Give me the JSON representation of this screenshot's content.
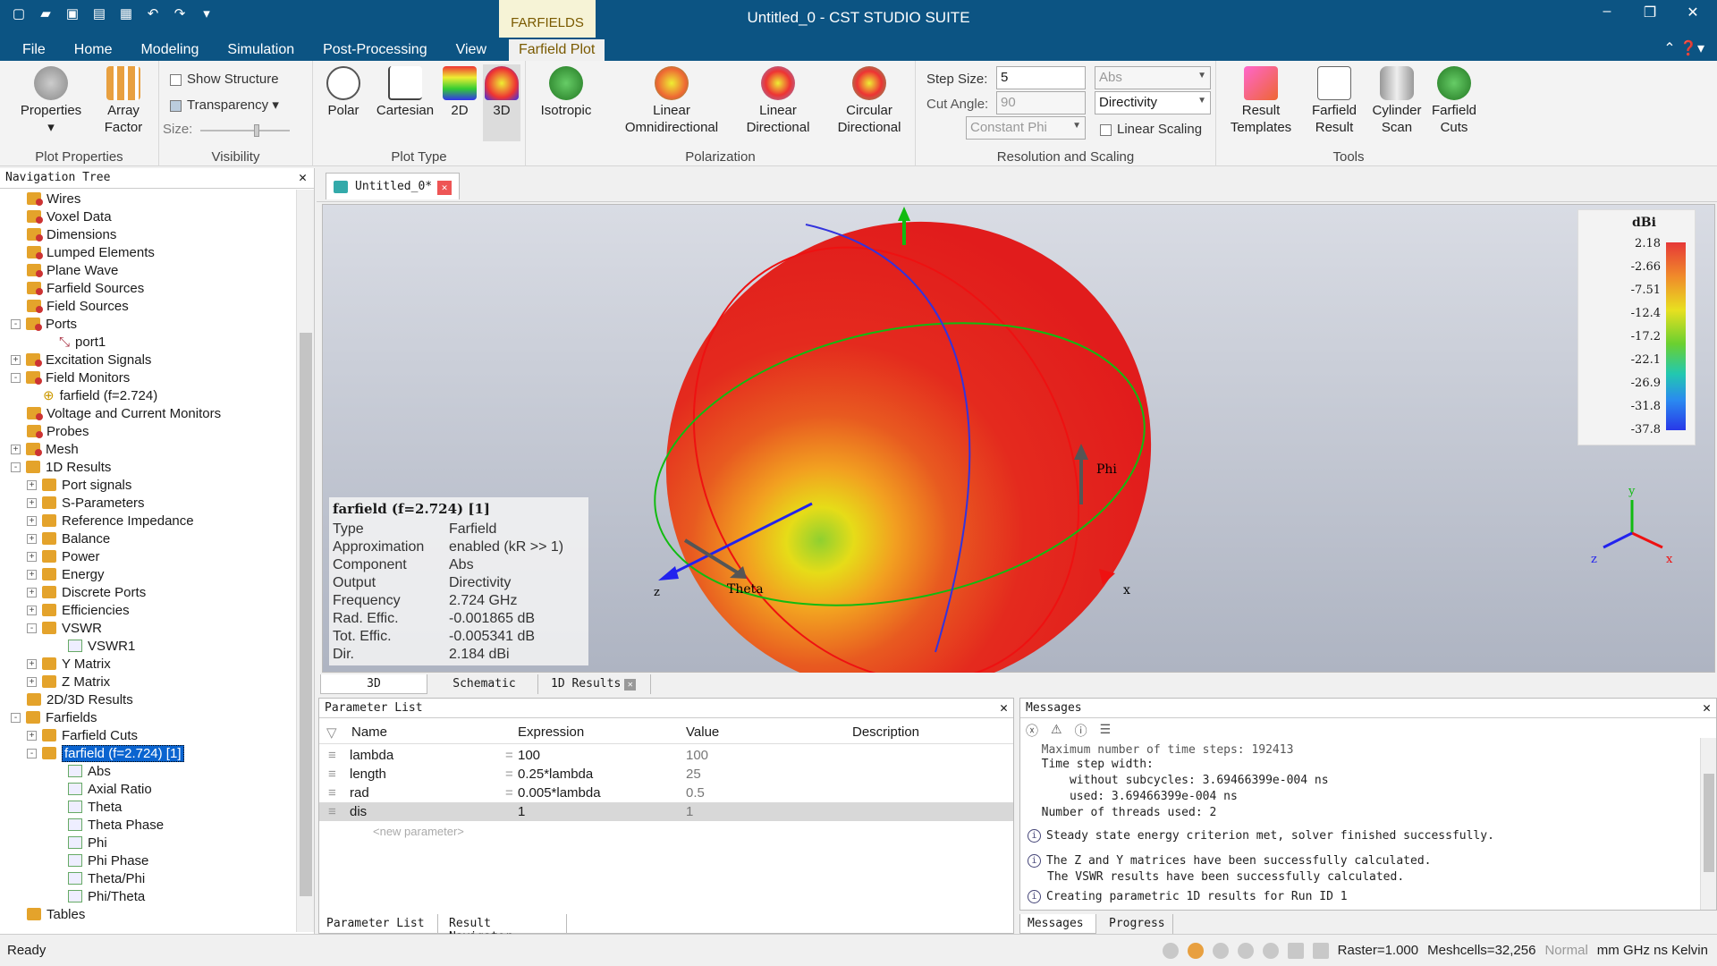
{
  "app": {
    "title": "Untitled_0 - CST STUDIO SUITE",
    "context_tab_group": "FARFIELDS"
  },
  "menu_tabs": [
    "File",
    "Home",
    "Modeling",
    "Simulation",
    "Post-Processing",
    "View",
    "Farfield Plot"
  ],
  "ribbon": {
    "plot_properties": {
      "group": "Plot Properties",
      "properties": "Properties",
      "array_factor": [
        "Array",
        "Factor"
      ]
    },
    "visibility": {
      "group": "Visibility",
      "show_structure": "Show Structure",
      "transparency": "Transparency",
      "size": "Size:"
    },
    "plot_type": {
      "group": "Plot Type",
      "polar": "Polar",
      "cartesian": "Cartesian",
      "2d": "2D",
      "3d": "3D"
    },
    "polarization": {
      "group": "Polarization",
      "isotropic": "Isotropic",
      "linear_omni": [
        "Linear",
        "Omnidirectional"
      ],
      "linear_dir": [
        "Linear",
        "Directional"
      ],
      "circular_dir": [
        "Circular",
        "Directional"
      ]
    },
    "resolution": {
      "group": "Resolution and Scaling",
      "step_size_label": "Step Size:",
      "step_size": "5",
      "cut_angle_label": "Cut Angle:",
      "cut_angle": "90",
      "constant_phi": "Constant Phi",
      "abs": "Abs",
      "directivity": "Directivity",
      "linear_scaling": "Linear Scaling"
    },
    "tools": {
      "group": "Tools",
      "result_templates": [
        "Result",
        "Templates"
      ],
      "farfield_result": [
        "Farfield",
        "Result"
      ],
      "cylinder_scan": [
        "Cylinder",
        "Scan"
      ],
      "farfield_cuts": [
        "Farfield",
        "Cuts"
      ]
    }
  },
  "nav": {
    "title": "Navigation Tree",
    "items": [
      "Wires",
      "Voxel Data",
      "Dimensions",
      "Lumped Elements",
      "Plane Wave",
      "Farfield Sources",
      "Field Sources",
      "Ports",
      "port1",
      "Excitation Signals",
      "Field Monitors",
      "farfield (f=2.724)",
      "Voltage and Current Monitors",
      "Probes",
      "Mesh",
      "1D Results",
      "Port signals",
      "S-Parameters",
      "Reference Impedance",
      "Balance",
      "Power",
      "Energy",
      "Discrete Ports",
      "Efficiencies",
      "VSWR",
      "VSWR1",
      "Y Matrix",
      "Z Matrix",
      "2D/3D Results",
      "Farfields",
      "Farfield Cuts",
      "farfield (f=2.724) [1]",
      "Abs",
      "Axial Ratio",
      "Theta",
      "Theta Phase",
      "Phi",
      "Phi Phase",
      "Theta/Phi",
      "Phi/Theta",
      "Tables"
    ]
  },
  "doc_tab": "Untitled_0*",
  "info": {
    "header": "farfield (f=2.724) [1]",
    "rows": [
      [
        "Type",
        "Farfield"
      ],
      [
        "Approximation",
        "enabled (kR >> 1)"
      ],
      [
        "Component",
        "Abs"
      ],
      [
        "Output",
        "Directivity"
      ],
      [
        "Frequency",
        "2.724 GHz"
      ],
      [
        "Rad. Effic.",
        "-0.001865 dB"
      ],
      [
        "Tot. Effic.",
        "-0.005341 dB"
      ],
      [
        "Dir.",
        "2.184 dBi"
      ]
    ]
  },
  "axes_labels": {
    "z": "z",
    "x": "x",
    "theta": "Theta",
    "phi": "Phi",
    "tri_x": "x",
    "tri_y": "y",
    "tri_z": "z"
  },
  "legend": {
    "unit": "dBi",
    "ticks": [
      "2.18",
      "-2.66",
      "-7.51",
      "-12.4",
      "-17.2",
      "-22.1",
      "-26.9",
      "-31.8",
      "-37.8"
    ]
  },
  "view_tabs": [
    "3D",
    "Schematic",
    "1D Results"
  ],
  "params": {
    "title": "Parameter List",
    "headers": [
      "Name",
      "Expression",
      "Value",
      "Description"
    ],
    "rows": [
      [
        "lambda",
        "100",
        "100"
      ],
      [
        "length",
        "0.25*lambda",
        "25"
      ],
      [
        "rad",
        "0.005*lambda",
        "0.5"
      ],
      [
        "dis",
        "1",
        "1"
      ]
    ],
    "new_placeholder": "<new parameter>",
    "tabs": [
      "Parameter List",
      "Result Navigator"
    ]
  },
  "messages": {
    "title": "Messages",
    "lines": [
      "  Maximum number of time steps: 192413",
      "  Time step width:",
      "      without subcycles: 3.69466399e-004 ns",
      "      used: 3.69466399e-004 ns",
      "  Number of threads used: 2",
      "Steady state energy criterion met, solver finished successfully.",
      "The Z and Y matrices have been successfully calculated.",
      "The VSWR results have been successfully calculated.",
      "Creating parametric 1D results for Run ID 1"
    ],
    "tabs": [
      "Messages",
      "Progress"
    ]
  },
  "status": {
    "ready": "Ready",
    "raster": "Raster=1.000",
    "meshcells": "Meshcells=32,256",
    "normal": "Normal",
    "units": "mm GHz ns Kelvin"
  }
}
